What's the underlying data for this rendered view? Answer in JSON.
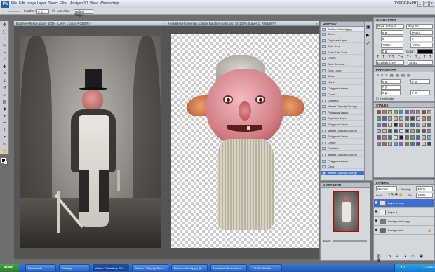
{
  "menubar": {
    "logo": "Ps",
    "items": [
      "File",
      "Edit",
      "Image",
      "Layer",
      "Select",
      "Filter",
      "Analysis",
      "3D",
      "View",
      "Window",
      "Help"
    ],
    "workspace": "TYPOGRAPHY",
    "win_btns": [
      "_",
      "□",
      "×"
    ]
  },
  "optbar": {
    "feather_label": "Feather:",
    "feather_value": "0 px",
    "antialias_label": "Anti-alias",
    "refine_label": "Refine Edge..."
  },
  "doc1": {
    "title": "Butcher-Wendy.jpg @ 100% (Layer 1 copy, RGB/8#) *"
  },
  "doc2": {
    "title": "Headless Horseman zombie Butcher mask.psd @ 100% (Layer 1, RGB/8#) *"
  },
  "history": {
    "tab": "HISTORY",
    "snapshot": "Butcher-Wendy.jpg",
    "items": [
      "Open",
      "Duplicate Layer",
      "Auto Tone",
      "Fade Auto Tone",
      "Levels",
      "Auto Contrast",
      "Drop Layer",
      "Move",
      "Move",
      "Polygonal Lasso",
      "Clone",
      "Deselect",
      "Master Opacity Change",
      "Polygonal Lasso",
      "Duplicate Layer",
      "Polygonal Lasso",
      "Master Opacity Change",
      "Polygonal Lasso",
      "Delete",
      "Deselect",
      "Master Opacity Change",
      "Polygonal Lasso",
      "Clear",
      "Master Opacity Change"
    ]
  },
  "character": {
    "tab": "CHARACTER",
    "font": "Book Antiqua",
    "style": "Regular",
    "size": "6 pt",
    "leading": "(Auto)",
    "kerning": "0",
    "tracking": "0",
    "vscale": "100%",
    "hscale": "100%",
    "baseline": "0 pt",
    "color_label": "Color:",
    "language": "English: USA",
    "aa": "Sharp"
  },
  "paragraph": {
    "tab": "PARAGRAPH",
    "indent_left": "0 pt",
    "indent_right": "0 pt",
    "first_line": "0 pt",
    "space_before": "0 pt",
    "space_after": "0 pt",
    "hyphenate": "Hyphenate"
  },
  "styles": {
    "tab": "STYLES",
    "colors": [
      "#b23b3b",
      "#c77b3a",
      "#d6c73e",
      "#6fae4b",
      "#4b8fc9",
      "#7b57b8",
      "#d46aa5",
      "#8a8a8a",
      "#9c3f2e",
      "#c2a45e",
      "#5c9a7a",
      "#3c6ea8",
      "#a8a8a8",
      "#d8b26a",
      "#7ab8d9",
      "#8c5c3a",
      "#4a4a4a",
      "#c4c4c4",
      "#b9845c",
      "#6b8f3c",
      "#5d7fc0",
      "#a3467b",
      "#e0d5b0",
      "#2f2f2f",
      "#bb6f4f",
      "#7d9f9f",
      "#4f6f4f",
      "#9a7cc4",
      "#c9a0a0",
      "#6a6a6a",
      "#a0c0e0",
      "#d0d090",
      "#704020",
      "#305070",
      "#e6e6e6",
      "#503050",
      "#b0b070",
      "#3a7a3a",
      "#804040",
      "#909090",
      "#5a5a9a",
      "#c08050",
      "#407070",
      "#d8d8d8",
      "#202020",
      "#a06060",
      "#60a060",
      "#6060a0",
      "#c0c060",
      "#60c0c0",
      "#c060c0",
      "#787878",
      "#e0a050",
      "#50a0e0",
      "#a050e0",
      "#808040",
      "#408080",
      "#804080",
      "#cccccc",
      "#444444"
    ]
  },
  "navigator": {
    "tab": "NAVIGATOR",
    "zoom": "100%"
  },
  "layers": {
    "tab": "LAYERS",
    "blend": "Normal",
    "opacity_label": "Opacity:",
    "opacity": "100%",
    "lock_label": "Lock:",
    "fill_label": "Fill:",
    "fill": "100%",
    "items": [
      "Layer 1 copy",
      "Layer 1",
      "Background copy",
      "Background"
    ]
  },
  "taskbar": {
    "start": "start",
    "tasks": [
      "Downloads",
      "Desktop",
      "Adobe Photoshop CS...",
      "Search - Step-by-Step...",
      "Butcher-Wendy.jpg @...",
      "Headless Horseman z...",
      "PS Certification"
    ],
    "clock": "2:23 PM"
  }
}
